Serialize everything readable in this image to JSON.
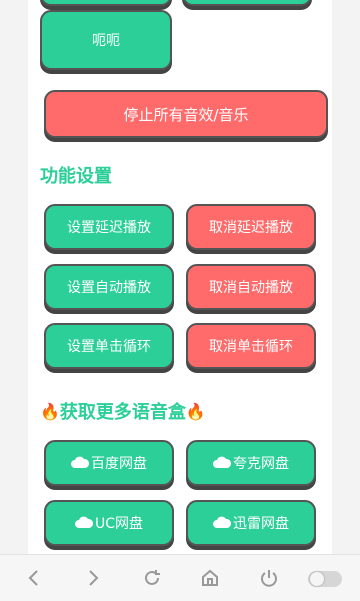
{
  "top_buttons": {
    "eh_label": "呃呃"
  },
  "stop_all_label": "停止所有音效/音乐",
  "function_settings": {
    "title": "功能设置",
    "buttons": {
      "set_delay": "设置延迟播放",
      "cancel_delay": "取消延迟播放",
      "set_auto": "设置自动播放",
      "cancel_auto": "取消自动播放",
      "set_loop": "设置单击循环",
      "cancel_loop": "取消单击循环"
    }
  },
  "more_boxes": {
    "fire_icon": "🔥",
    "title": "获取更多语音盒",
    "buttons": {
      "baidu": "百度网盘",
      "quark": "夸克网盘",
      "uc": "UC网盘",
      "xunlei": "迅雷网盘"
    }
  },
  "colors": {
    "green": "#2bcf97",
    "red": "#ff6b6b"
  },
  "bottom_nav": {
    "icons": [
      "back-icon",
      "forward-icon",
      "refresh-icon",
      "home-icon",
      "power-icon",
      "toggle-switch"
    ]
  }
}
